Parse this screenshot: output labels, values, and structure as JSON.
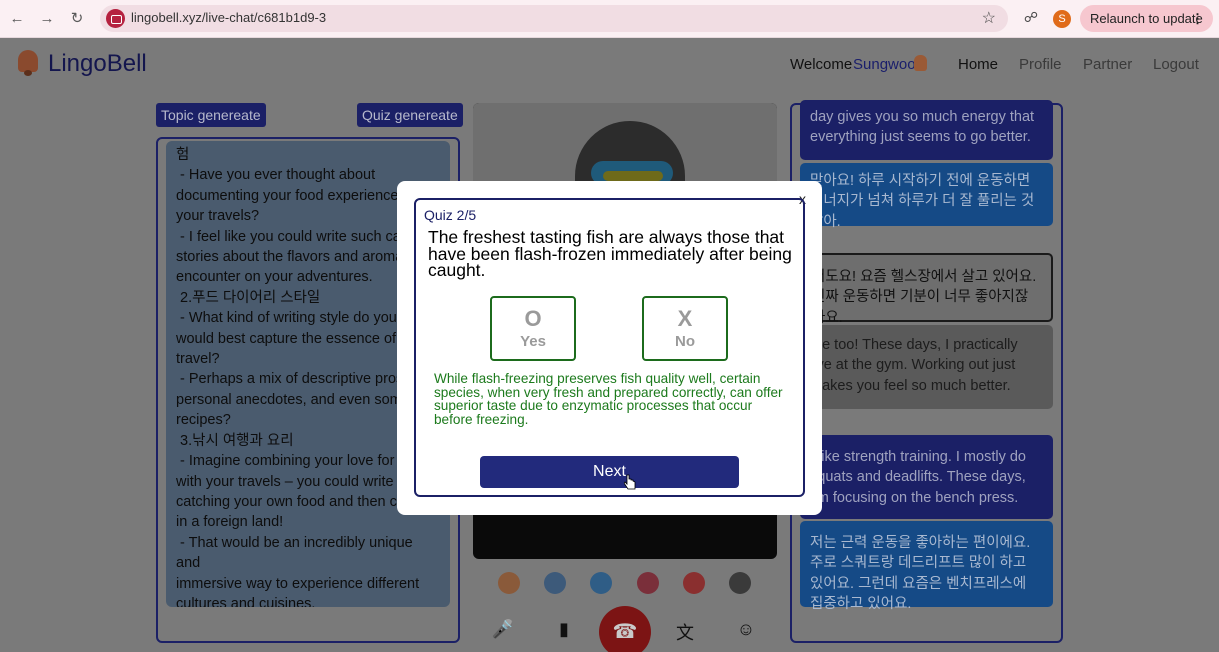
{
  "browser": {
    "url": "lingobell.xyz/live-chat/c681b1d9-3",
    "profile_initial": "S",
    "relaunch_label": "Relaunch to update"
  },
  "header": {
    "brand": "LingoBell",
    "welcome": "Welcome",
    "username": "Sungwoo",
    "nav": [
      "Home",
      "Profile",
      "Partner",
      "Logout"
    ]
  },
  "left": {
    "topic_button": "Topic genereate",
    "quiz_button": "Quiz genereate",
    "topic_text": "험\n - Have you ever thought about documenting your food experiences d\nyour travels?\n - I feel like you could write such capt\nstories about the flavors and aromas\nencounter on your adventures.\n 2.푸드 다이어리 스타일\n - What kind of writing style do you th\nwould best capture the essence of fo\ntravel?\n - Perhaps a mix of descriptive prose\npersonal anecdotes, and even some\nrecipes?\n 3.낚시 여행과 요리\n - Imagine combining your love for fis\nwith your travels – you could write ab\ncatching your own food and then coo\nin a foreign land!\n - That would be an incredibly unique and\nimmersive way to experience different\ncultures and cuisines."
  },
  "chat": {
    "messages": [
      {
        "style": "dark",
        "text": "day gives you so much energy that everything just seems to go better."
      },
      {
        "style": "blue",
        "text": "맞아요! 하루 시작하기 전에 운동하면 에너지가 넘쳐 하루가 더 잘 풀리는 것 같아."
      },
      {
        "style": "white",
        "text": "저도요! 요즘 헬스장에서 살고 있어요. 진짜 운동하면 기분이 너무 좋아지잖아요."
      },
      {
        "style": "gray",
        "text": "Me too! These days, I practically live at the gym. Working out just makes you feel so much better."
      },
      {
        "style": "dark",
        "text": "I like strength training. I mostly do squats and deadlifts. These days, I'm focusing on the bench press."
      },
      {
        "style": "blue",
        "text": "저는 근력 운동을 좋아하는 편이에요. 주로 스쿼트랑 데드리프트 많이 하고 있어요. 그런데 요즘은 벤치프레스에 집중하고 있어요."
      }
    ]
  },
  "quiz": {
    "close": "x",
    "counter": "Quiz 2/5",
    "question": "The freshest tasting fish are always those that have been flash-frozen immediately after being caught.",
    "option_o_symbol": "O",
    "option_o_label": "Yes",
    "option_x_symbol": "X",
    "option_x_label": "No",
    "explanation": "While flash-freezing preserves fish quality well, certain species, when very fresh and prepared correctly, can offer superior taste due to enzymatic processes that occur before freezing.",
    "next_label": "Next"
  },
  "colors": {
    "navy": "#1b2066",
    "explanation_green": "#1c7a1c",
    "hangup_red": "#7c1414"
  }
}
